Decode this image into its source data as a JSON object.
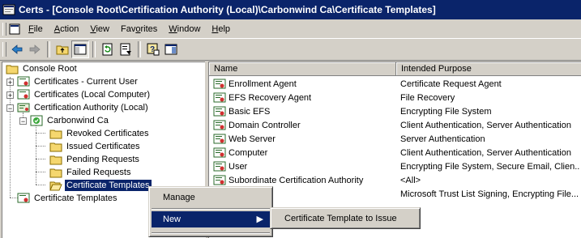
{
  "window": {
    "title": "Certs - [Console Root\\Certification Authority (Local)\\Carbonwind Ca\\Certificate Templates]"
  },
  "menu": [
    {
      "label": "File",
      "accel": "F",
      "rest": "ile"
    },
    {
      "label": "Action",
      "accel": "A",
      "rest": "ction"
    },
    {
      "label": "View",
      "accel": "V",
      "rest": "iew"
    },
    {
      "label": "Favorites",
      "accel": "o",
      "pre": "Fav",
      "rest": "rites"
    },
    {
      "label": "Window",
      "accel": "W",
      "rest": "indow"
    },
    {
      "label": "Help",
      "accel": "H",
      "rest": "elp"
    }
  ],
  "toolbar": [
    "back-icon",
    "forward-icon",
    "up-folder-icon",
    "show-hide-tree-icon",
    "refresh-icon",
    "export-list-icon",
    "help-icon",
    "properties-pane-icon"
  ],
  "tree": {
    "items": [
      {
        "label": "Console Root"
      },
      {
        "label": "Certificates - Current User"
      },
      {
        "label": "Certificates (Local Computer)"
      },
      {
        "label": "Certification Authority (Local)"
      },
      {
        "label": "Carbonwind Ca"
      },
      {
        "label": "Revoked Certificates"
      },
      {
        "label": "Issued Certificates"
      },
      {
        "label": "Pending Requests"
      },
      {
        "label": "Failed Requests"
      },
      {
        "label": "Certificate Templates"
      },
      {
        "label": "Certificate Templates"
      }
    ]
  },
  "list": {
    "columns": [
      "Name",
      "Intended Purpose"
    ],
    "rows": [
      {
        "name": "Enrollment Agent",
        "purpose": "Certificate Request Agent"
      },
      {
        "name": "EFS Recovery Agent",
        "purpose": "File Recovery"
      },
      {
        "name": "Basic EFS",
        "purpose": "Encrypting File System"
      },
      {
        "name": "Domain Controller",
        "purpose": "Client Authentication, Server Authentication"
      },
      {
        "name": "Web Server",
        "purpose": "Server Authentication"
      },
      {
        "name": "Computer",
        "purpose": "Client Authentication, Server Authentication"
      },
      {
        "name": "User",
        "purpose": "Encrypting File System, Secure Email, Clien..."
      },
      {
        "name": "Subordinate Certification Authority",
        "purpose": "<All>"
      },
      {
        "name": "r",
        "purpose": "Microsoft Trust List Signing, Encrypting File..."
      }
    ]
  },
  "context_menu": {
    "items": [
      {
        "label": "Manage"
      },
      {
        "label": "New"
      }
    ],
    "submenu": {
      "label": "Certificate Template to Issue"
    }
  },
  "colors": {
    "selection": "#0a246a",
    "face": "#d4d0c8"
  }
}
